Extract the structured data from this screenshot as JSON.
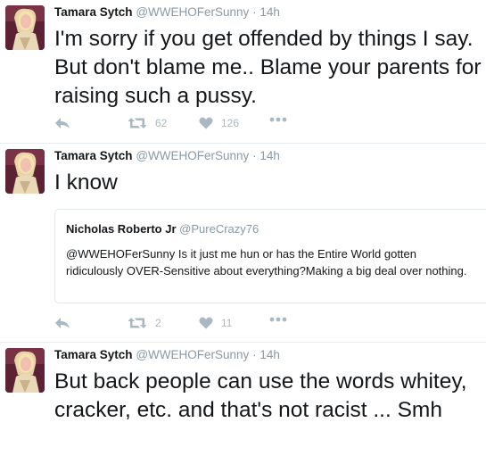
{
  "tweets": [
    {
      "author_name": "Tamara Sytch",
      "author_handle": "@WWEHOFerSunny",
      "separator": "·",
      "time": "14h",
      "text": "I'm sorry if you get offended by things I say. But don't blame me.. Blame your parents for raising such a pussy.",
      "retweets": "62",
      "likes": "126"
    },
    {
      "author_name": "Tamara Sytch",
      "author_handle": "@WWEHOFerSunny",
      "separator": "·",
      "time": "14h",
      "text": "I know",
      "quote": {
        "author_name": "Nicholas Roberto Jr",
        "author_handle": "@PureCrazy76",
        "text": "@WWEHOFerSunny Is it just me hun or has the Entire World gotten ridiculously OVER-Sensitive about everything?Making a big deal over nothing."
      },
      "retweets": "2",
      "likes": "11"
    },
    {
      "author_name": "Tamara Sytch",
      "author_handle": "@WWEHOFerSunny",
      "separator": "·",
      "time": "14h",
      "text": "But back people can use the words whitey, cracker, etc. and that's not racist ...  Smh"
    }
  ],
  "icons": {
    "reply": "reply-arrow-icon",
    "retweet": "retweet-icon",
    "like": "heart-icon",
    "more": "more-dots-icon"
  },
  "colors": {
    "text": "#14171a",
    "muted": "#8899a6",
    "action_icons": "#aab8c2",
    "divider": "#e6ecf0"
  }
}
